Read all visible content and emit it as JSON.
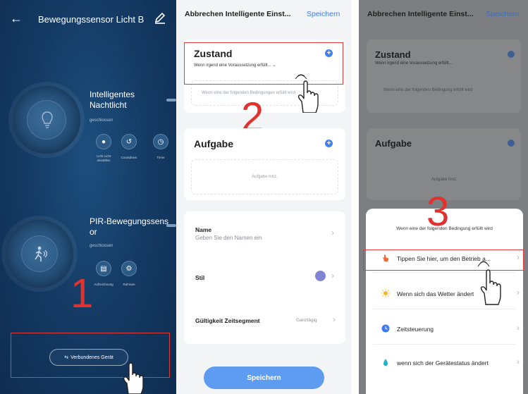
{
  "panel1": {
    "title": "Bewegungssensor Licht B",
    "device1": {
      "name_line1": "Intelligentes",
      "name_line2": "Nachtlicht",
      "status": "geschlossen",
      "buttons": [
        {
          "label_line1": "Licht Licht",
          "label_line2": "einstellen",
          "icon": "light-icon"
        },
        {
          "label_line1": "Countdown",
          "label_line2": "",
          "icon": "countdown-icon"
        },
        {
          "label_line1": "Timer",
          "label_line2": "",
          "icon": "timer-icon"
        }
      ]
    },
    "device2": {
      "name_line1": "PIR-Bewegungssens",
      "name_line2": "or",
      "status": "geschlossen",
      "buttons": [
        {
          "label_line1": "Aufzeichnung",
          "icon": "record-icon"
        },
        {
          "label_line1": "Rahmen",
          "icon": "settings-icon"
        }
      ]
    },
    "connected_button": "Verbundenes Gerät",
    "step": "1"
  },
  "panel2": {
    "cancel": "Abbrechen Intelligente Einst...",
    "save": "Speichern",
    "zustand_title": "Zustand",
    "zustand_sub": "Wenn irgend eine Voraussetzung erfüllt...",
    "zustand_hint": "Wenn eine der folgenden Bedingungen erfüllt wird",
    "aufgabe_title": "Aufgabe",
    "aufgabe_empty": "Aufgabe hinz.",
    "name_title": "Name",
    "name_sub": "Geben Sie den Namen ein",
    "stil_title": "Stil",
    "validity_title": "Gültigkeit Zeitsegment",
    "validity_value": "Ganztägig",
    "bottom_save": "Speichern",
    "step": "2",
    "style_color": "#7f83d1"
  },
  "panel3": {
    "cancel": "Abbrechen Intelligente Einst...",
    "save": "Speichern",
    "zustand_title": "Zustand",
    "zustand_sub": "Wenn irgend eine Voraussetzung erfüllt...",
    "zustand_hint": "Wenn eine der folgenden Bedingung erfüllt wird",
    "aufgabe_title": "Aufgabe",
    "aufgabe_empty": "Aufgabe hinz.",
    "sheet_head": "Wenn eine der folgenden Bedingung erfüllt wird",
    "options": [
      {
        "text": "Tippen Sie hier, um den Betrieb a...",
        "icon": "tap-hand-icon",
        "color": "#f26b3a"
      },
      {
        "text": "Wenn sich das Wetter ändert",
        "icon": "sun-icon",
        "color": "#f5b82e"
      },
      {
        "text": "Zeitsteuerung",
        "icon": "clock-icon",
        "color": "#3d7bf5"
      },
      {
        "text": "wenn sich der Gerätestatus ändert",
        "icon": "device-status-icon",
        "color": "#22b3c9"
      }
    ],
    "step": "3"
  }
}
